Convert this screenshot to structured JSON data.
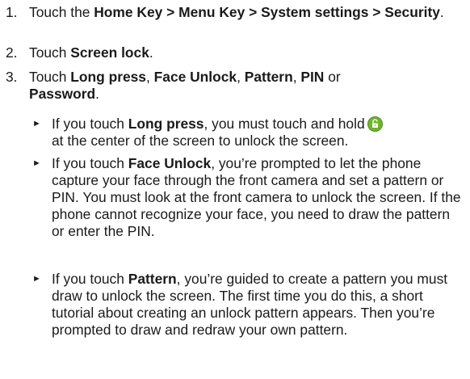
{
  "steps": [
    {
      "num": "1.",
      "t1": "Touch the ",
      "b1": "Home Key > Menu Key > System settings > Security",
      "t2": "."
    },
    {
      "num": "2.",
      "t1": "Touch ",
      "b1": "Screen lock",
      "t2": "."
    },
    {
      "num": "3.",
      "t1": "Touch ",
      "b1": "Long press",
      "t2": ", ",
      "b2": "Face Unlock",
      "t3": ", ",
      "b3": "Pattern",
      "t4": ", ",
      "b4": "PIN",
      "t5": " or ",
      "b5": "Password",
      "t6": "."
    }
  ],
  "bullet_glyph": "►",
  "subitems": [
    {
      "t1": "If you touch ",
      "b1": "Long press",
      "t2": ", you must touch and hold",
      "t3": " at the center of the screen to unlock the screen."
    },
    {
      "t1": "If you touch ",
      "b1": "Face Unlock",
      "t2": ", you’re prompted to let the phone capture your face through the front camera and set a pattern or PIN. You must look at the front camera to unlock the screen. If the phone cannot recognize your face, you need to draw the pattern or enter the PIN."
    },
    {
      "t1": "If you touch ",
      "b1": "Pattern",
      "t2": ", you’re guided to create a pattern you must draw to unlock the screen. The first time you do this, a short tutorial about creating an unlock pattern appears. Then you’re prompted to draw and redraw your own pattern."
    }
  ],
  "icons": {
    "unlock": "green-lock-icon"
  },
  "colors": {
    "text": "#1a1a1a",
    "lock_icon_green": "#6fb52c"
  }
}
